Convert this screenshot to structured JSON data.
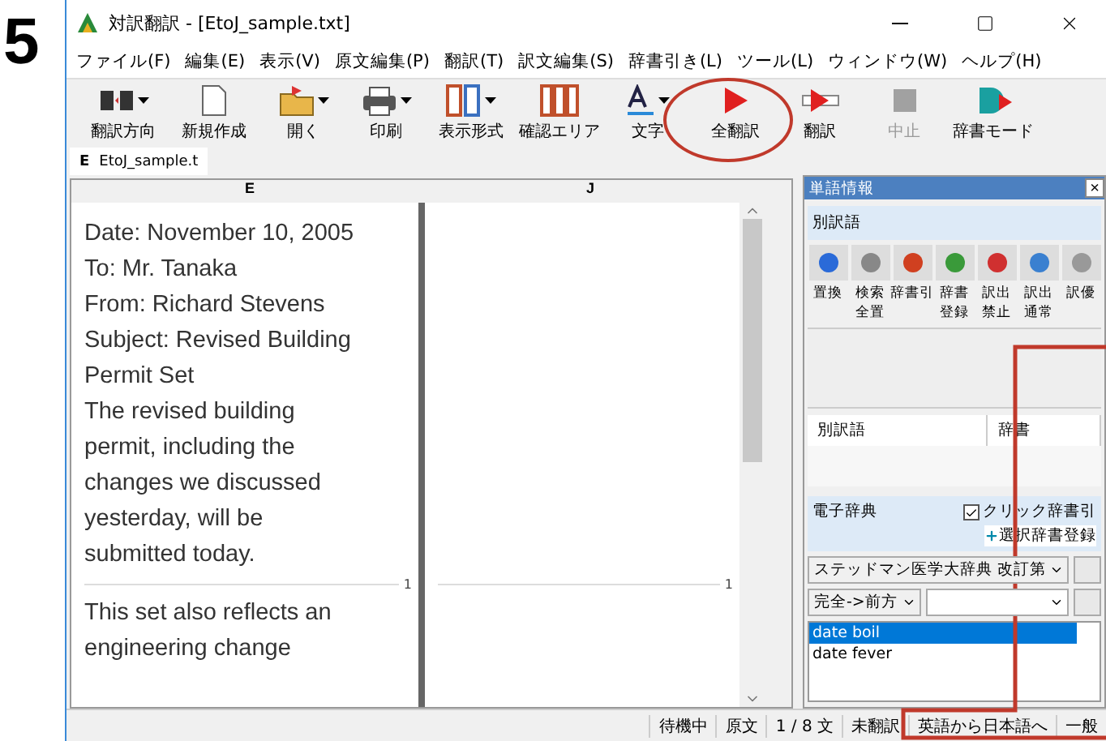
{
  "step_number": "5",
  "window": {
    "title": "対訳翻訳 - [EtoJ_sample.txt]"
  },
  "menu": [
    "ファイル(F)",
    "編集(E)",
    "表示(V)",
    "原文編集(P)",
    "翻訳(T)",
    "訳文編集(S)",
    "辞書引き(L)",
    "ツール(L)",
    "ウィンドウ(W)",
    "ヘルプ(H)"
  ],
  "toolbar": [
    {
      "kind": "direction",
      "label": "翻訳方向",
      "disabled": false,
      "dropdown": true
    },
    {
      "kind": "new",
      "label": "新規作成",
      "disabled": false,
      "dropdown": false
    },
    {
      "kind": "open",
      "label": "開く",
      "disabled": false,
      "dropdown": true
    },
    {
      "kind": "print",
      "label": "印刷",
      "disabled": false,
      "dropdown": true
    },
    {
      "kind": "layout",
      "label": "表示形式",
      "disabled": false,
      "dropdown": true
    },
    {
      "kind": "check",
      "label": "確認エリア",
      "disabled": false,
      "dropdown": false
    },
    {
      "kind": "font",
      "label": "文字",
      "disabled": false,
      "dropdown": true
    },
    {
      "kind": "translate_all",
      "label": "全翻訳",
      "disabled": false,
      "dropdown": false
    },
    {
      "kind": "translate",
      "label": "翻訳",
      "disabled": false,
      "dropdown": false
    },
    {
      "kind": "stop",
      "label": "中止",
      "disabled": true,
      "dropdown": false
    },
    {
      "kind": "dict",
      "label": "辞書モード",
      "disabled": false,
      "dropdown": false
    }
  ],
  "document_tab": {
    "letter": "E",
    "label": "EtoJ_sample.t"
  },
  "editor": {
    "source_header": "E",
    "target_header": "J",
    "target_segment_number": "1",
    "segments": [
      {
        "number": "1",
        "lines": [
          "Date: November 10, 2005",
          "To: Mr. Tanaka",
          "From: Richard Stevens",
          "Subject: Revised Building",
          "Permit Set",
          "The revised building",
          "permit, including the",
          "changes we discussed",
          "yesterday, will be",
          "submitted today."
        ]
      },
      {
        "lines": [
          "This set also reflects an",
          "engineering change"
        ]
      }
    ]
  },
  "word_panel": {
    "title": "単語情報",
    "close": "×",
    "section": "別訳語",
    "tools": [
      {
        "kind": "replace",
        "label": "置換"
      },
      {
        "kind": "search",
        "label": "検索全置"
      },
      {
        "kind": "lookup",
        "label": "辞書引"
      },
      {
        "kind": "register",
        "label": "辞書登録"
      },
      {
        "kind": "forbid",
        "label": "訳出禁止"
      },
      {
        "kind": "normal",
        "label": "訳出通常"
      },
      {
        "kind": "prefer",
        "label": "訳優"
      }
    ],
    "columns": [
      "別訳語",
      "辞書"
    ]
  },
  "dictionary": {
    "title": "電子辞典",
    "click_lookup": {
      "label": "クリック辞書引",
      "checked": true
    },
    "register_link": "選択辞書登録",
    "dictionary_select": "ステッドマン医学大辞典 改訂第",
    "match_select": "完全->前方",
    "results": [
      {
        "text": "date boil",
        "selected": true
      },
      {
        "text": "date fever",
        "selected": false
      }
    ]
  },
  "status_bar": [
    "待機中",
    "原文",
    "1 / 8 文",
    "未翻訳",
    "英語から日本語へ",
    "一般"
  ]
}
